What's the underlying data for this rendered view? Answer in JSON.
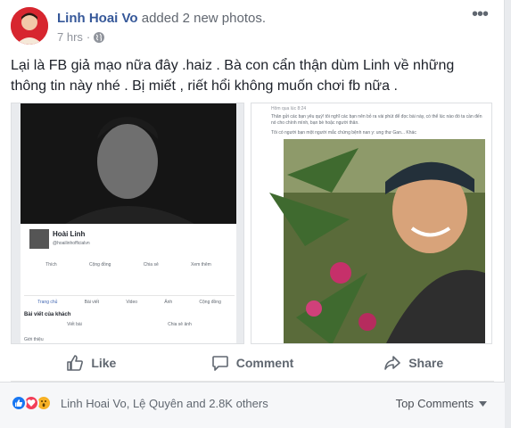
{
  "post": {
    "author": "Linh Hoai Vo",
    "action": "added 2 new photos.",
    "time": "7 hrs",
    "dot": "·",
    "text": "Lại là FB giả mạo nữa đây .haiz . Bà con cẩn thận dùm Linh về những thông tin này nhé . Bị miết , riết hổi không muốn chơi fb nữa ."
  },
  "photo_left": {
    "profile_name": "Hoài Linh",
    "profile_handle": "@hoailinhofficialvn",
    "tabs": [
      "Trang chủ",
      "Bài viết",
      "Video",
      "Ảnh",
      "Cộng đồng"
    ],
    "section_label": "Bài viết của khách",
    "write_label": "Viết bài",
    "photo_label": "Chia sẻ ảnh",
    "community_label": "Cộng đồng",
    "more_label": "Xem thêm",
    "share_label": "Chia sẻ",
    "like_label": "Thích",
    "bottom_label": "Giới thiệu"
  },
  "photo_right": {
    "caption": "Thân gửi các bạn yêu quý! tôi nghĩ các bạn nên bỏ ra vài phút để đọc bài này, có thể lúc nào đó ta cần đến nó cho chính mình, bạn bè hoặc người thân.",
    "caption2": "Tôi có người bạn một người mắc chứng bệnh nan y: ung thư Gan... Khác",
    "meta": "Hôm qua lúc 8:24"
  },
  "actions": {
    "like": "Like",
    "comment": "Comment",
    "share": "Share"
  },
  "reactions": {
    "summary": "Linh Hoai Vo, Lệ Quyên and 2.8K others",
    "sort": "Top Comments"
  },
  "colors": {
    "link": "#365899",
    "muted": "#606770",
    "like_blue": "#1877f2",
    "love_red": "#f33e58",
    "wow_yellow": "#f7b125"
  }
}
